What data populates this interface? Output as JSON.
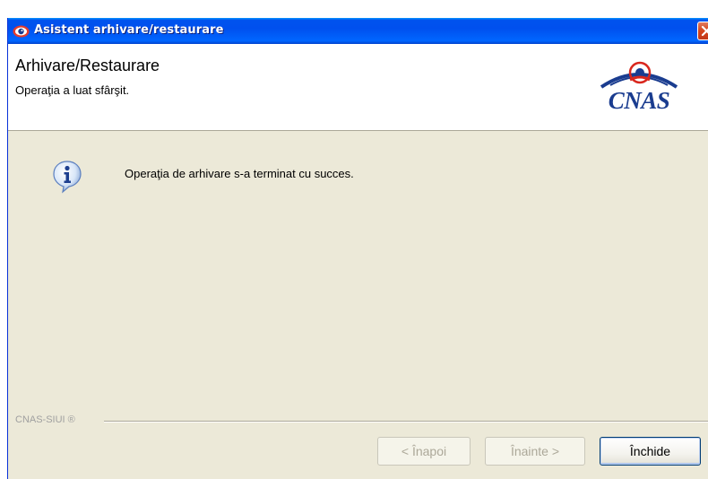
{
  "window": {
    "title": "Asistent arhivare/restaurare"
  },
  "header": {
    "title": "Arhivare/Restaurare",
    "subtitle": "Operaţia a luat sfârşit.",
    "logo_text": "CNAS"
  },
  "body": {
    "message": "Operaţia de arhivare s-a terminat cu succes."
  },
  "footer": {
    "brand": "CNAS-SIUI ®",
    "back_label": "< Înapoi",
    "next_label": "Înainte >",
    "close_label": "Închide"
  },
  "colors": {
    "titlebar": "#0053ee",
    "dialog_bg": "#ece9d8",
    "logo_blue": "#1a3c8f",
    "logo_red": "#d9261c",
    "disabled_text": "#aca899"
  }
}
